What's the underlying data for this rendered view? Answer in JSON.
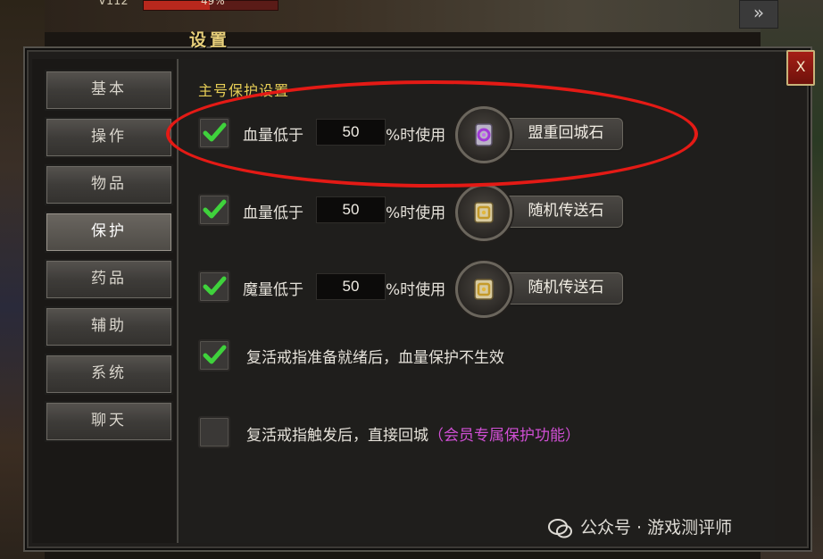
{
  "hud": {
    "level_text": "V112",
    "hp_percent_text": "49%",
    "hp_fraction": 0.49
  },
  "window": {
    "title": "设置",
    "close_label": "X"
  },
  "nav": {
    "items": [
      {
        "label": "基本"
      },
      {
        "label": "操作"
      },
      {
        "label": "物品"
      },
      {
        "label": "保护",
        "active": true
      },
      {
        "label": "药品"
      },
      {
        "label": "辅助"
      },
      {
        "label": "系统"
      },
      {
        "label": "聊天"
      }
    ]
  },
  "protection": {
    "section_title": "主号保护设置",
    "rows": [
      {
        "checked": true,
        "label": "血量低于",
        "value": "50",
        "suffix": "%时使用",
        "item_name": "盟重回城石",
        "item_icon": "purple-scroll-icon"
      },
      {
        "checked": true,
        "label": "血量低于",
        "value": "50",
        "suffix": "%时使用",
        "item_name": "随机传送石",
        "item_icon": "gold-scroll-icon"
      },
      {
        "checked": true,
        "label": "魔量低于",
        "value": "50",
        "suffix": "%时使用",
        "item_name": "随机传送石",
        "item_icon": "gold-scroll-icon"
      }
    ],
    "revive_ready_option": {
      "checked": true,
      "label": "复活戒指准备就绪后，血量保护不生效"
    },
    "revive_trigger_option": {
      "checked": false,
      "label": "复活戒指触发后，直接回城",
      "member_note": "（会员专属保护功能）"
    }
  },
  "watermark": {
    "text": "公众号 · 游戏测评师"
  },
  "colors": {
    "accent_title": "#e8cf56",
    "member_note": "#d04fd4",
    "highlight_ring": "#e41a15",
    "close_button": "#a51f16"
  }
}
